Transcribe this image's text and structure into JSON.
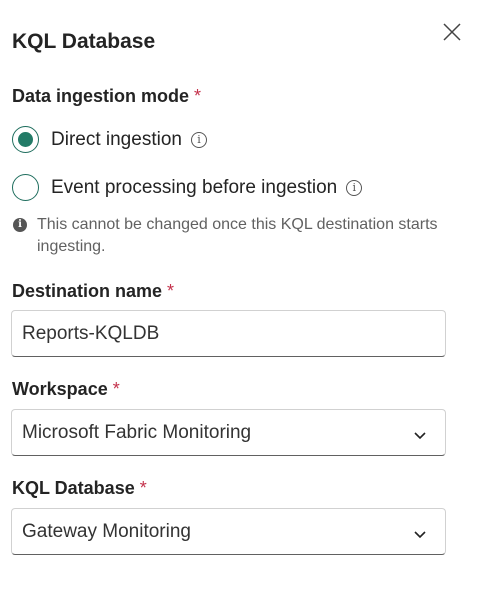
{
  "title": "KQL Database",
  "ingestion": {
    "label": "Data ingestion mode",
    "required": "*",
    "options": [
      {
        "label": "Direct ingestion",
        "selected": true
      },
      {
        "label": "Event processing before ingestion",
        "selected": false
      }
    ],
    "note": "This cannot be changed once this KQL destination starts ingesting."
  },
  "destination": {
    "label": "Destination name",
    "required": "*",
    "value": "Reports-KQLDB"
  },
  "workspace": {
    "label": "Workspace",
    "required": "*",
    "value": "Microsoft Fabric Monitoring"
  },
  "kql_database": {
    "label": "KQL Database",
    "required": "*",
    "value": "Gateway Monitoring"
  },
  "colors": {
    "accent": "#237b67",
    "required": "#c4314b"
  }
}
